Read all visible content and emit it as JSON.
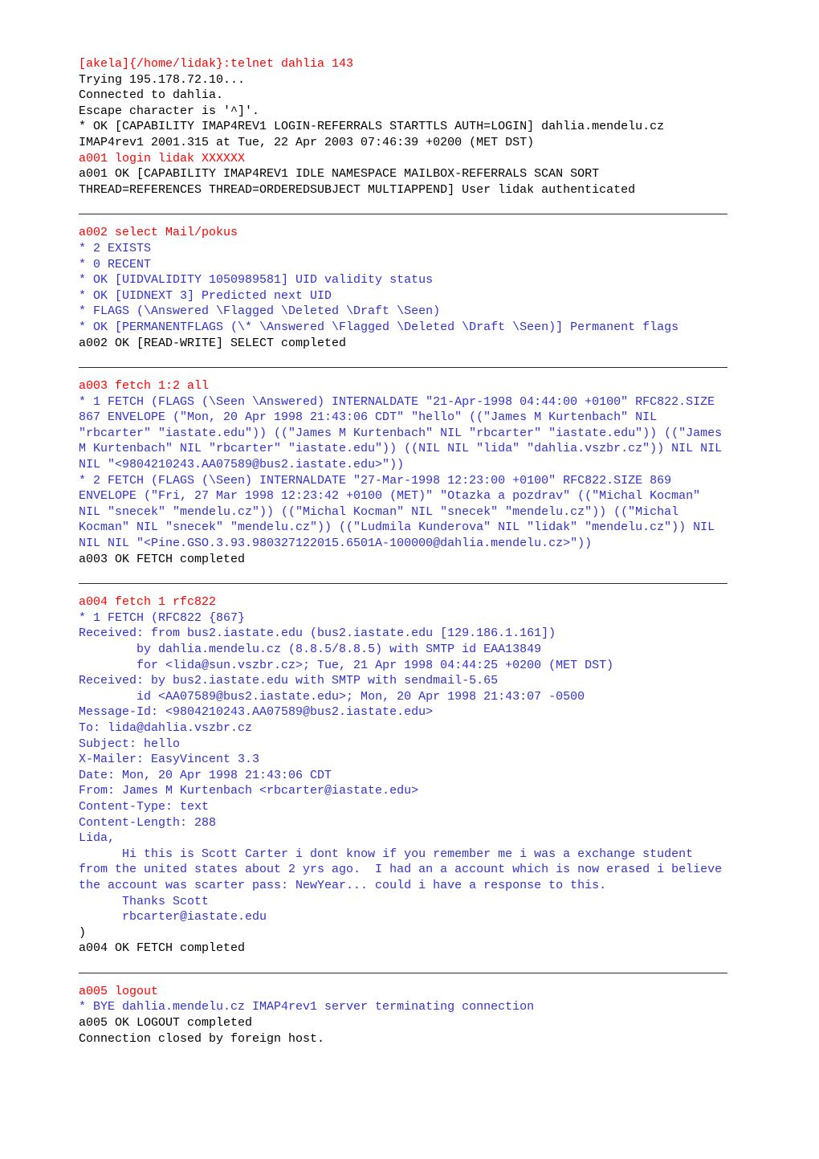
{
  "document": {
    "title": "IMAP telnet session transcript",
    "colors": {
      "local_output": "#000000",
      "user_command": "#ff0000",
      "server_response": "#3333cc",
      "divider": "#2b2b2b",
      "background": "#ffffff"
    }
  },
  "blocks": [
    {
      "id": "block-login",
      "name": "connect-and-login",
      "lines": [
        {
          "kind": "command",
          "text_prefix": "[akela]{/home/lidak}:",
          "text": "[akela]{/home/lidak}:telnet dahlia 143"
        },
        {
          "kind": "local",
          "text": "Trying 195.178.72.10..."
        },
        {
          "kind": "local",
          "text": "Connected to dahlia."
        },
        {
          "kind": "local",
          "text": "Escape character is '^]'."
        },
        {
          "kind": "local",
          "text": "* OK [CAPABILITY IMAP4REV1 LOGIN-REFERRALS STARTTLS AUTH=LOGIN] dahlia.mendelu.cz IMAP4rev1 2001.315 at Tue, 22 Apr 2003 07:46:39 +0200 (MET DST)"
        },
        {
          "kind": "command",
          "text": "a001 login lidak XXXXXX"
        },
        {
          "kind": "local",
          "text": "a001 OK [CAPABILITY IMAP4REV1 IDLE NAMESPACE MAILBOX-REFERRALS SCAN SORT THREAD=REFERENCES THREAD=ORDEREDSUBJECT MULTIAPPEND] User lidak authenticated"
        }
      ]
    },
    {
      "id": "block-select",
      "name": "select-mailbox",
      "lines": [
        {
          "kind": "command",
          "text": "a002 select Mail/pokus"
        },
        {
          "kind": "server",
          "text": "* 2 EXISTS"
        },
        {
          "kind": "server",
          "text": "* 0 RECENT"
        },
        {
          "kind": "server",
          "text": "* OK [UIDVALIDITY 1050989581] UID validity status"
        },
        {
          "kind": "server",
          "text": "* OK [UIDNEXT 3] Predicted next UID"
        },
        {
          "kind": "server",
          "text": "* FLAGS (\\Answered \\Flagged \\Deleted \\Draft \\Seen)"
        },
        {
          "kind": "server",
          "text": "* OK [PERMANENTFLAGS (\\* \\Answered \\Flagged \\Deleted \\Draft \\Seen)] Permanent flags"
        },
        {
          "kind": "local",
          "text": "a002 OK [READ-WRITE] SELECT completed"
        }
      ]
    },
    {
      "id": "block-fetch-all",
      "name": "fetch-all-envelopes",
      "lines": [
        {
          "kind": "command",
          "text": "a003 fetch 1:2 all"
        },
        {
          "kind": "server",
          "text": "* 1 FETCH (FLAGS (\\Seen \\Answered) INTERNALDATE \"21-Apr-1998 04:44:00 +0100\" RFC822.SIZE 867 ENVELOPE (\"Mon, 20 Apr 1998 21:43:06 CDT\" \"hello\" ((\"James M Kurtenbach\" NIL \"rbcarter\" \"iastate.edu\")) ((\"James M Kurtenbach\" NIL \"rbcarter\" \"iastate.edu\")) ((\"James M Kurtenbach\" NIL \"rbcarter\" \"iastate.edu\")) ((NIL NIL \"lida\" \"dahlia.vszbr.cz\")) NIL NIL NIL \"<9804210243.AA07589@bus2.iastate.edu>\"))"
        },
        {
          "kind": "server",
          "text": "* 2 FETCH (FLAGS (\\Seen) INTERNALDATE \"27-Mar-1998 12:23:00 +0100\" RFC822.SIZE 869 ENVELOPE (\"Fri, 27 Mar 1998 12:23:42 +0100 (MET)\" \"Otazka a pozdrav\" ((\"Michal Kocman\" NIL \"snecek\" \"mendelu.cz\")) ((\"Michal Kocman\" NIL \"snecek\" \"mendelu.cz\")) ((\"Michal Kocman\" NIL \"snecek\" \"mendelu.cz\")) ((\"Ludmila Kunderova\" NIL \"lidak\" \"mendelu.cz\")) NIL NIL NIL \"<Pine.GSO.3.93.980327122015.6501A-100000@dahlia.mendelu.cz>\"))"
        },
        {
          "kind": "local",
          "text": "a003 OK FETCH completed"
        }
      ]
    },
    {
      "id": "block-fetch-rfc822",
      "name": "fetch-message-source",
      "lines": [
        {
          "kind": "command",
          "text": "a004 fetch 1 rfc822"
        },
        {
          "kind": "server",
          "text": "* 1 FETCH (RFC822 {867}"
        },
        {
          "kind": "server",
          "text": "Received: from bus2.iastate.edu (bus2.iastate.edu [129.186.1.161])"
        },
        {
          "kind": "server",
          "text": "        by dahlia.mendelu.cz (8.8.5/8.8.5) with SMTP id EAA13849"
        },
        {
          "kind": "server",
          "text": "        for <lida@sun.vszbr.cz>; Tue, 21 Apr 1998 04:44:25 +0200 (MET DST)"
        },
        {
          "kind": "server",
          "text": "Received: by bus2.iastate.edu with SMTP with sendmail-5.65"
        },
        {
          "kind": "server",
          "text": "        id <AA07589@bus2.iastate.edu>; Mon, 20 Apr 1998 21:43:07 -0500"
        },
        {
          "kind": "server",
          "text": "Message-Id: <9804210243.AA07589@bus2.iastate.edu>"
        },
        {
          "kind": "server",
          "text": "To: lida@dahlia.vszbr.cz"
        },
        {
          "kind": "server",
          "text": "Subject: hello"
        },
        {
          "kind": "server",
          "text": "X-Mailer: EasyVincent 3.3"
        },
        {
          "kind": "server",
          "text": "Date: Mon, 20 Apr 1998 21:43:06 CDT"
        },
        {
          "kind": "server",
          "text": "From: James M Kurtenbach <rbcarter@iastate.edu>"
        },
        {
          "kind": "server",
          "text": "Content-Type: text"
        },
        {
          "kind": "server",
          "text": "Content-Length: 288"
        },
        {
          "kind": "server",
          "text": "Lida,"
        },
        {
          "kind": "server",
          "text": "      Hi this is Scott Carter i dont know if you remember me i was a exchange student from the united states about 2 yrs ago.  I had an a account which is now erased i believe the account was scarter pass: NewYear... could i have a response to this."
        },
        {
          "kind": "server",
          "text": "      Thanks Scott"
        },
        {
          "kind": "server",
          "text": "      rbcarter@iastate.edu"
        },
        {
          "kind": "local",
          "text": ")"
        },
        {
          "kind": "local",
          "text": "a004 OK FETCH completed"
        }
      ]
    },
    {
      "id": "block-logout",
      "name": "logout",
      "lines": [
        {
          "kind": "command",
          "text": "a005 logout"
        },
        {
          "kind": "server",
          "text": "* BYE dahlia.mendelu.cz IMAP4rev1 server terminating connection"
        },
        {
          "kind": "local",
          "text": "a005 OK LOGOUT completed"
        },
        {
          "kind": "local",
          "text": "Connection closed by foreign host."
        }
      ]
    }
  ],
  "dividers_after_block": [
    "block-login",
    "block-select",
    "block-fetch-all",
    "block-fetch-rfc822"
  ]
}
